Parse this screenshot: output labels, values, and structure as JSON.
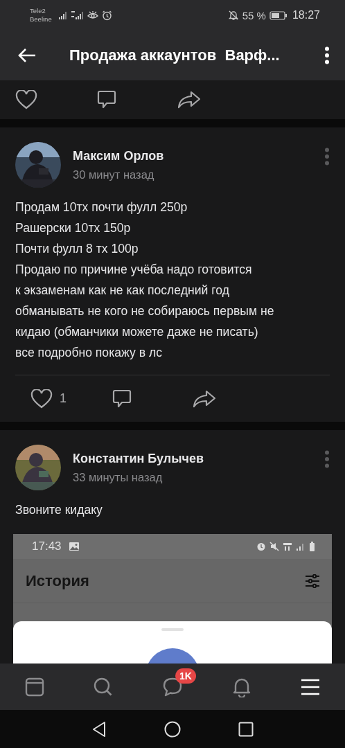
{
  "status_bar": {
    "carrier_1": "Tele2",
    "carrier_2": "Beeline",
    "battery": "55 %",
    "time": "18:27"
  },
  "app_bar": {
    "title": "Продажа аккаунтов  Варф..."
  },
  "previous_post": {
    "liked": false
  },
  "posts": [
    {
      "author": "Максим Орлов",
      "time": "30 минут назад",
      "text": "Продам 10тх почти фулл 250р\nРашерски 10тх 150р\nПочти фулл 8 тх 100р\nПродаю по причине учёба надо готовится\nк экзаменам как не как последний год\nобманывать не кого не собираюсь первым не\nкидаю (обманчики можете даже не писать)\nвсе подробно покажу в лс",
      "likes": "1",
      "liked": false
    },
    {
      "author": "Константин Булычев",
      "time": "33 минуты назад",
      "text": "Звоните кидаку",
      "attachment": {
        "time": "17:43",
        "title": "История"
      }
    }
  ],
  "bottom_nav": [
    {
      "kind": "feed",
      "selected": false
    },
    {
      "kind": "search",
      "selected": false
    },
    {
      "kind": "messages",
      "selected": false,
      "badge": "1K"
    },
    {
      "kind": "notifications",
      "selected": false
    },
    {
      "kind": "menu",
      "selected": true
    }
  ]
}
